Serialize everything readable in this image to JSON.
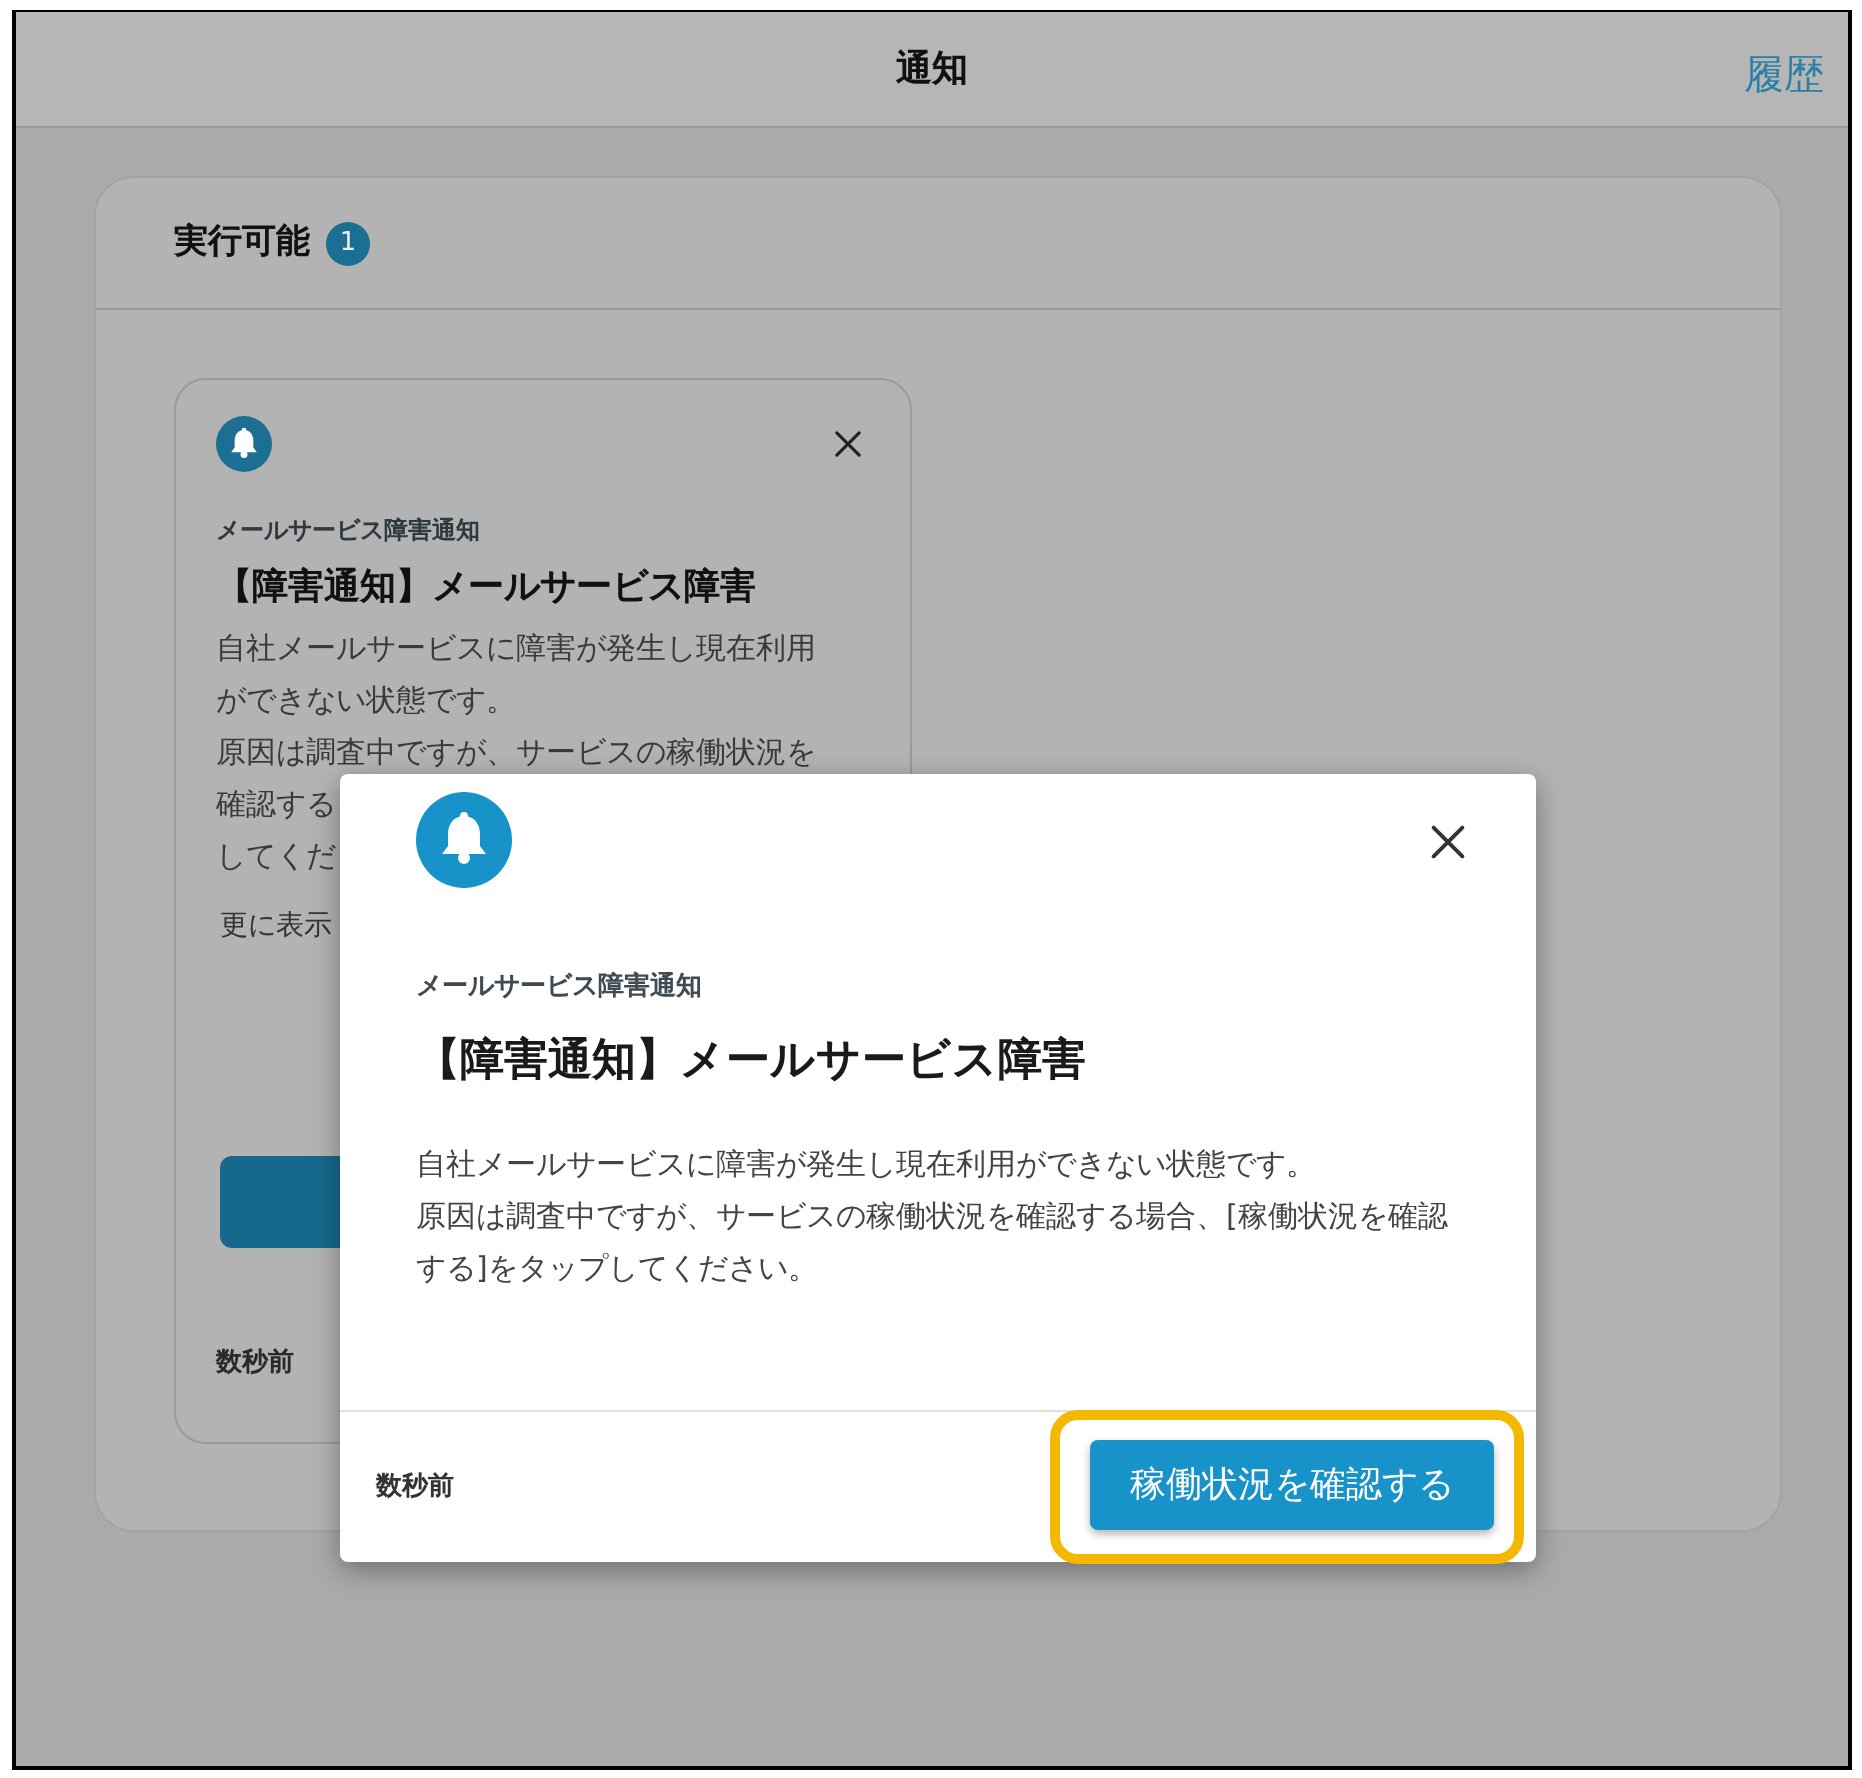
{
  "header": {
    "title": "通知",
    "history_link": "履歴"
  },
  "section": {
    "title": "実行可能",
    "count": "1"
  },
  "card": {
    "category": "メールサービス障害通知",
    "title": "【障害通知】メールサービス障害",
    "body_lines": [
      "自社メールサービスに障害が発生し現在利用",
      "ができない状態です。",
      "原因は調査中ですが、サービスの稼働状況を",
      "確認する",
      "してくだ"
    ],
    "more_link": "更に表示",
    "time": "数秒前"
  },
  "dialog": {
    "category": "メールサービス障害通知",
    "title": "【障害通知】メールサービス障害",
    "paragraphs": [
      "自社メールサービスに障害が発生し現在利用ができない状態です。",
      "原因は調査中ですが、サービスの稼働状況を確認する場合、[稼働状況を確認する]をタップしてください。"
    ],
    "time": "数秒前",
    "action": {
      "label": "稼働状況を確認する",
      "highlighted": true
    }
  }
}
